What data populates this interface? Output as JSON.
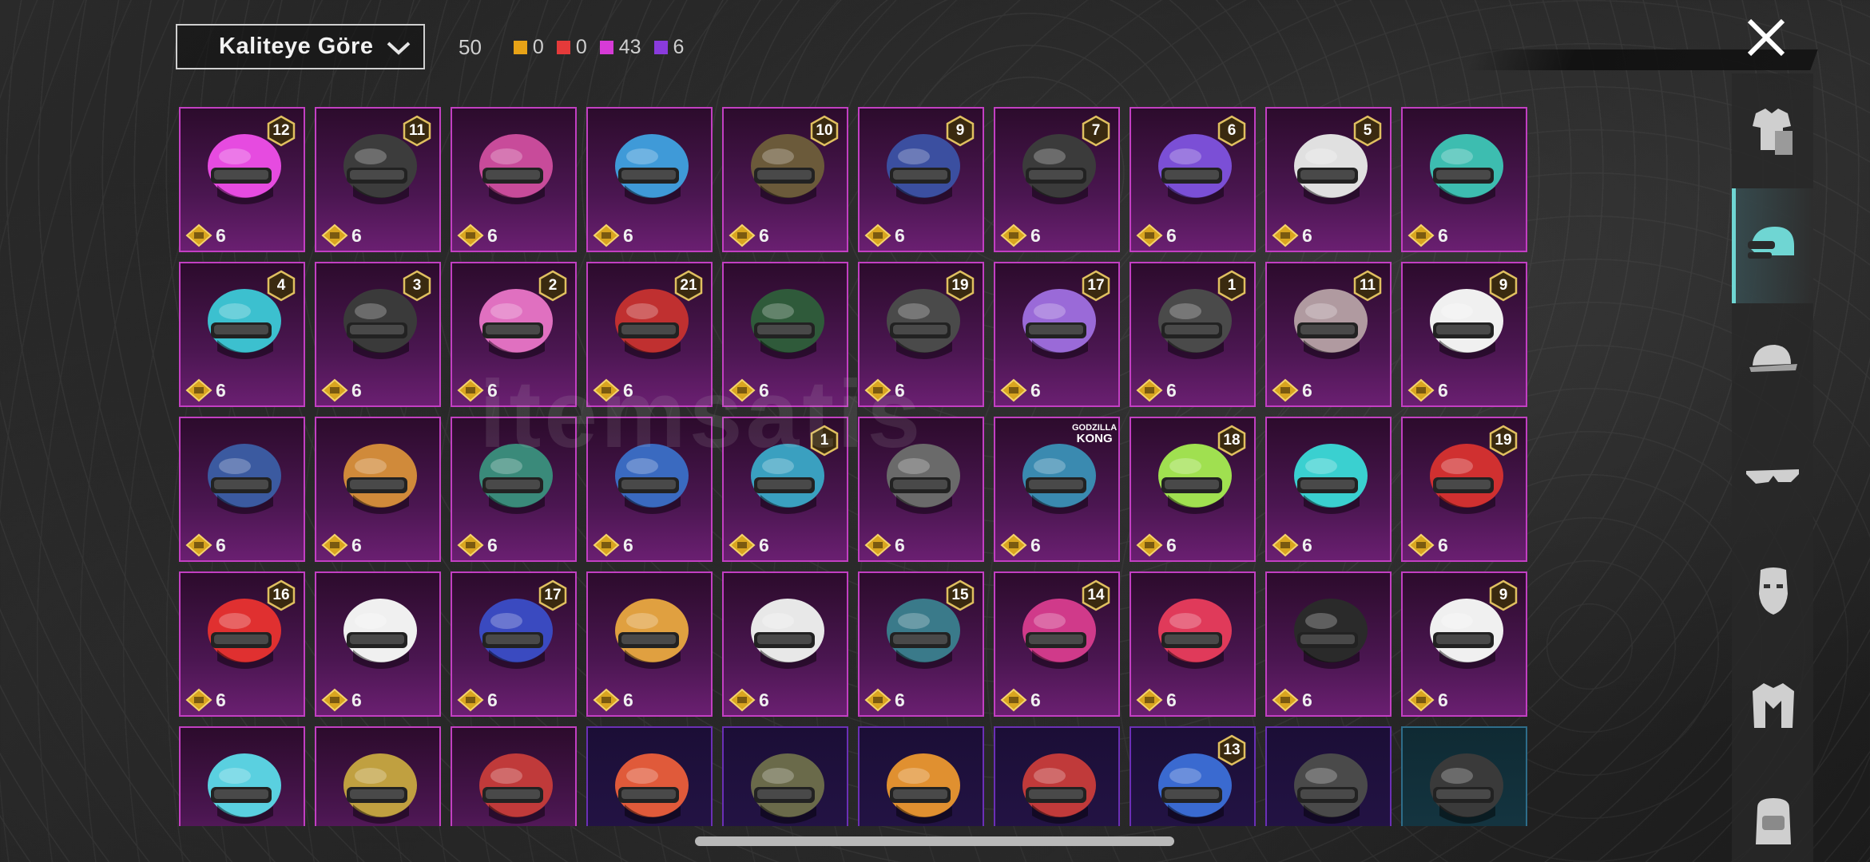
{
  "toolbar": {
    "sort_label": "Kaliteye Göre",
    "total_count": "50",
    "quality_counts": [
      {
        "color": "#e8a317",
        "value": "0"
      },
      {
        "color": "#e53a3a",
        "value": "0"
      },
      {
        "color": "#d63bd6",
        "value": "43"
      },
      {
        "color": "#8a3bdc",
        "value": "6"
      }
    ]
  },
  "watermark": "itemsatis",
  "items": [
    {
      "level": "12",
      "price": "6",
      "helmet": "#e64be0",
      "rarity": "purple"
    },
    {
      "level": "11",
      "price": "6",
      "helmet": "#3c3c3c",
      "rarity": "purple"
    },
    {
      "level": "",
      "price": "6",
      "helmet": "#c84b9a",
      "rarity": "purple"
    },
    {
      "level": "",
      "price": "6",
      "helmet": "#3f9ad8",
      "rarity": "purple"
    },
    {
      "level": "10",
      "price": "6",
      "helmet": "#6b5a3a",
      "rarity": "purple"
    },
    {
      "level": "9",
      "price": "6",
      "helmet": "#3b4fa0",
      "rarity": "purple"
    },
    {
      "level": "7",
      "price": "6",
      "helmet": "#3b3b3b",
      "rarity": "purple"
    },
    {
      "level": "6",
      "price": "6",
      "helmet": "#7b4fd6",
      "rarity": "purple"
    },
    {
      "level": "5",
      "price": "6",
      "helmet": "#e0e0e0",
      "rarity": "purple"
    },
    {
      "level": "",
      "price": "6",
      "helmet": "#3dbdb0",
      "rarity": "purple"
    },
    {
      "level": "4",
      "price": "6",
      "helmet": "#3cc0cf",
      "rarity": "purple"
    },
    {
      "level": "3",
      "price": "6",
      "helmet": "#3a3a3a",
      "rarity": "purple"
    },
    {
      "level": "2",
      "price": "6",
      "helmet": "#e070c0",
      "rarity": "purple"
    },
    {
      "level": "21",
      "price": "6",
      "helmet": "#c03030",
      "rarity": "purple"
    },
    {
      "level": "",
      "price": "6",
      "helmet": "#2f5a3a",
      "rarity": "purple"
    },
    {
      "level": "19",
      "price": "6",
      "helmet": "#4a4a4a",
      "rarity": "purple"
    },
    {
      "level": "17",
      "price": "6",
      "helmet": "#9a6ad8",
      "rarity": "purple"
    },
    {
      "level": "1",
      "price": "6",
      "helmet": "#4a4a4a",
      "rarity": "purple"
    },
    {
      "level": "11",
      "price": "6",
      "helmet": "#b09aa0",
      "rarity": "purple"
    },
    {
      "level": "9",
      "price": "6",
      "helmet": "#f0f0f0",
      "rarity": "purple"
    },
    {
      "level": "",
      "price": "6",
      "helmet": "#3b5aa0",
      "rarity": "purple"
    },
    {
      "level": "",
      "price": "6",
      "helmet": "#d08a3a",
      "rarity": "purple"
    },
    {
      "level": "",
      "price": "6",
      "helmet": "#3a8a7a",
      "rarity": "purple"
    },
    {
      "level": "",
      "price": "6",
      "helmet": "#3a6ac0",
      "rarity": "purple"
    },
    {
      "level": "1",
      "price": "6",
      "helmet": "#3aa0c0",
      "rarity": "purple"
    },
    {
      "level": "",
      "price": "6",
      "helmet": "#6a6a6a",
      "rarity": "purple"
    },
    {
      "level": "",
      "price": "6",
      "helmet": "#3a8ab0",
      "rarity": "purple",
      "tag_top": "GODZILLA",
      "tag_bottom": "KONG"
    },
    {
      "level": "18",
      "price": "6",
      "helmet": "#a0e050",
      "rarity": "purple"
    },
    {
      "level": "",
      "price": "6",
      "helmet": "#3ad0d0",
      "rarity": "purple"
    },
    {
      "level": "19",
      "price": "6",
      "helmet": "#d03030",
      "rarity": "purple"
    },
    {
      "level": "16",
      "price": "6",
      "helmet": "#e03030",
      "rarity": "purple"
    },
    {
      "level": "",
      "price": "6",
      "helmet": "#f0f0f0",
      "rarity": "purple"
    },
    {
      "level": "17",
      "price": "6",
      "helmet": "#3a4ac0",
      "rarity": "purple"
    },
    {
      "level": "",
      "price": "6",
      "helmet": "#e0a040",
      "rarity": "purple"
    },
    {
      "level": "",
      "price": "6",
      "helmet": "#e8e8e8",
      "rarity": "purple"
    },
    {
      "level": "15",
      "price": "6",
      "helmet": "#3a7a8a",
      "rarity": "purple"
    },
    {
      "level": "14",
      "price": "6",
      "helmet": "#d03a8a",
      "rarity": "purple"
    },
    {
      "level": "",
      "price": "6",
      "helmet": "#e03a5a",
      "rarity": "purple"
    },
    {
      "level": "",
      "price": "6",
      "helmet": "#2a2a2a",
      "rarity": "purple"
    },
    {
      "level": "9",
      "price": "6",
      "helmet": "#f0f0f0",
      "rarity": "purple"
    },
    {
      "level": "",
      "price": "",
      "helmet": "#5ad0e0",
      "rarity": "purple"
    },
    {
      "level": "",
      "price": "",
      "helmet": "#c0a040",
      "rarity": "purple"
    },
    {
      "level": "",
      "price": "",
      "helmet": "#c03a3a",
      "rarity": "purple"
    },
    {
      "level": "",
      "price": "",
      "helmet": "#e05a3a",
      "rarity": "dim"
    },
    {
      "level": "",
      "price": "",
      "helmet": "#6a6a4a",
      "rarity": "dim"
    },
    {
      "level": "",
      "price": "",
      "helmet": "#e09030",
      "rarity": "dim"
    },
    {
      "level": "",
      "price": "",
      "helmet": "#c03a3a",
      "rarity": "dim"
    },
    {
      "level": "13",
      "price": "",
      "helmet": "#3a6ad0",
      "rarity": "dim"
    },
    {
      "level": "",
      "price": "",
      "helmet": "#4a4a4a",
      "rarity": "dim"
    },
    {
      "level": "",
      "price": "",
      "helmet": "#3a3a3a",
      "rarity": "teal"
    }
  ],
  "sidebar": [
    {
      "name": "outfit-icon",
      "active": false
    },
    {
      "name": "helmet-icon",
      "active": true
    },
    {
      "name": "cap-icon",
      "active": false
    },
    {
      "name": "glasses-icon",
      "active": false
    },
    {
      "name": "mask-icon",
      "active": false
    },
    {
      "name": "jacket-icon",
      "active": false
    },
    {
      "name": "backpack-icon",
      "active": false
    }
  ]
}
